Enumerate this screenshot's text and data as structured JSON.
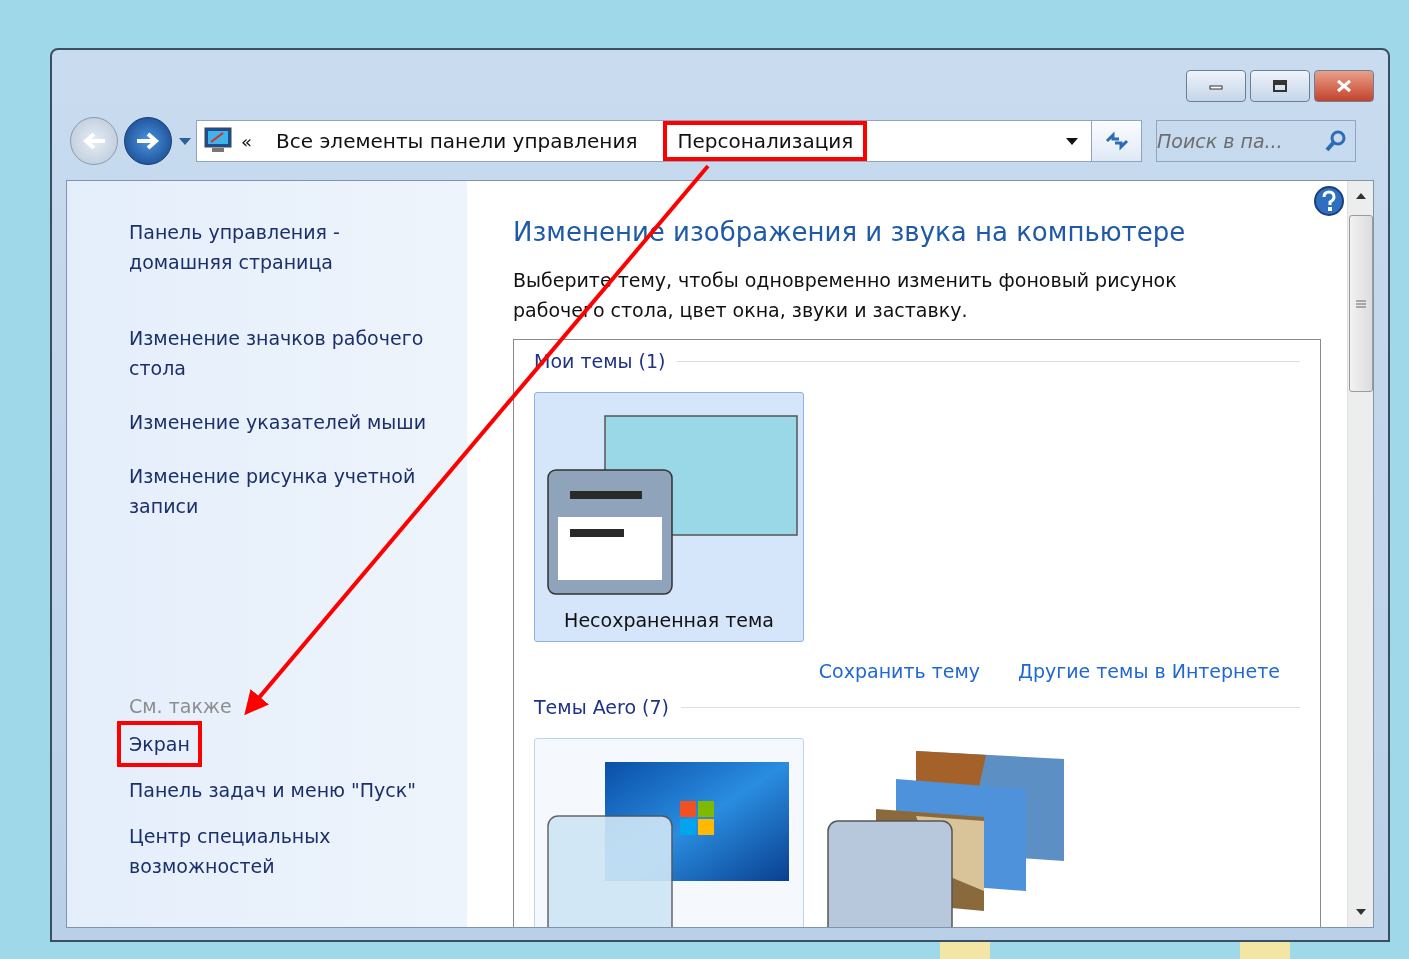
{
  "address_bar": {
    "overflow": "«",
    "segments": [
      {
        "label": "Все элементы панели управления",
        "highlighted": false
      },
      {
        "label": "Персонализация",
        "highlighted": true
      }
    ]
  },
  "search": {
    "placeholder": "Поиск в па..."
  },
  "sidebar": {
    "home_link": {
      "label": "Панель управления - домашняя страница",
      "highlighted": false
    },
    "tasks": [
      {
        "label": "Изменение значков рабочего стола",
        "highlighted": false
      },
      {
        "label": "Изменение указателей мыши",
        "highlighted": false
      },
      {
        "label": "Изменение рисунка учетной записи",
        "highlighted": false
      }
    ],
    "see_also": {
      "title": "См. также",
      "items": [
        {
          "label": "Экран",
          "highlighted": true
        },
        {
          "label": "Панель задач и меню \"Пуск\"",
          "highlighted": false
        },
        {
          "label": "Центр специальных возможностей",
          "highlighted": false
        }
      ]
    }
  },
  "content": {
    "title": "Изменение изображения и звука на компьютере",
    "description": "Выберите тему, чтобы одновременно изменить фоновый рисунок рабочего стола, цвет окна, звуки и заставку.",
    "groups": [
      {
        "title": "Мои темы (1)",
        "themes": [
          {
            "kind": "custom",
            "name": "Несохраненная тема",
            "selected": true,
            "hovered": false
          }
        ],
        "links": [
          "Сохранить тему",
          "Другие темы в Интернете"
        ]
      },
      {
        "title": "Темы Aero (7)",
        "themes": [
          {
            "kind": "windows7",
            "selected": false,
            "hovered": true
          },
          {
            "kind": "landscapes",
            "selected": false,
            "hovered": false
          }
        ]
      }
    ]
  }
}
